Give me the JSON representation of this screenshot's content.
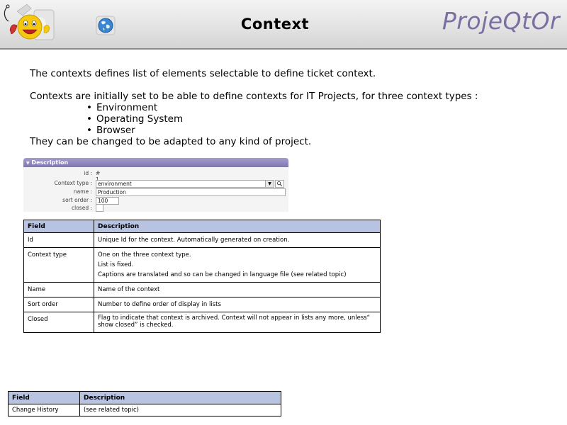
{
  "header": {
    "title": "Context",
    "brand": "ProjeQtOr",
    "logo_icon": "smiley-mascot-icon",
    "globe_icon": "globe-icon",
    "colors": {
      "brand": "#7b6fa2",
      "bar": "#8c8c8c"
    }
  },
  "intro": {
    "line1": "The contexts defines list of elements selectable to define ticket context.",
    "line2": "Contexts are initially set to be able to define contexts for IT Projects, for three context types :",
    "bullets": [
      "Environment",
      "Operating System",
      "Browser"
    ],
    "bullet_char": "•",
    "line3": "They can be changed to be adapted to any kind of project."
  },
  "form": {
    "section_title": "Description",
    "collapse_icon": "▼",
    "fields": {
      "id_label": "id :",
      "id_value": "# 1",
      "type_label": "Context type :",
      "type_value": "environment",
      "name_label": "name :",
      "name_value": "Production",
      "sort_label": "sort order :",
      "sort_value": "100",
      "closed_label": "closed :"
    },
    "dropdown_icon": "▼",
    "search_icon": "🔍"
  },
  "table1": {
    "headers": [
      "Field",
      "Description"
    ],
    "rows": [
      {
        "field": "Id",
        "desc": [
          "Unique Id for the context. Automatically generated on creation."
        ]
      },
      {
        "field": "Context type",
        "desc": [
          "One on the three context type.",
          "List is fixed.",
          "Captions are translated and so can be changed in language file (see related topic)"
        ]
      },
      {
        "field": "Name",
        "desc": [
          "Name of the context"
        ]
      },
      {
        "field": "Sort order",
        "desc": [
          "Number to define order of display in lists"
        ]
      },
      {
        "field": "Closed",
        "desc": [
          "Flag to indicate that context is archived. Context will not appear in lists any more, unless“ show closed” is checked."
        ]
      }
    ]
  },
  "table2": {
    "headers": [
      "Field",
      "Description"
    ],
    "rows": [
      {
        "field": "Change History",
        "desc": "(see related topic)"
      }
    ]
  }
}
